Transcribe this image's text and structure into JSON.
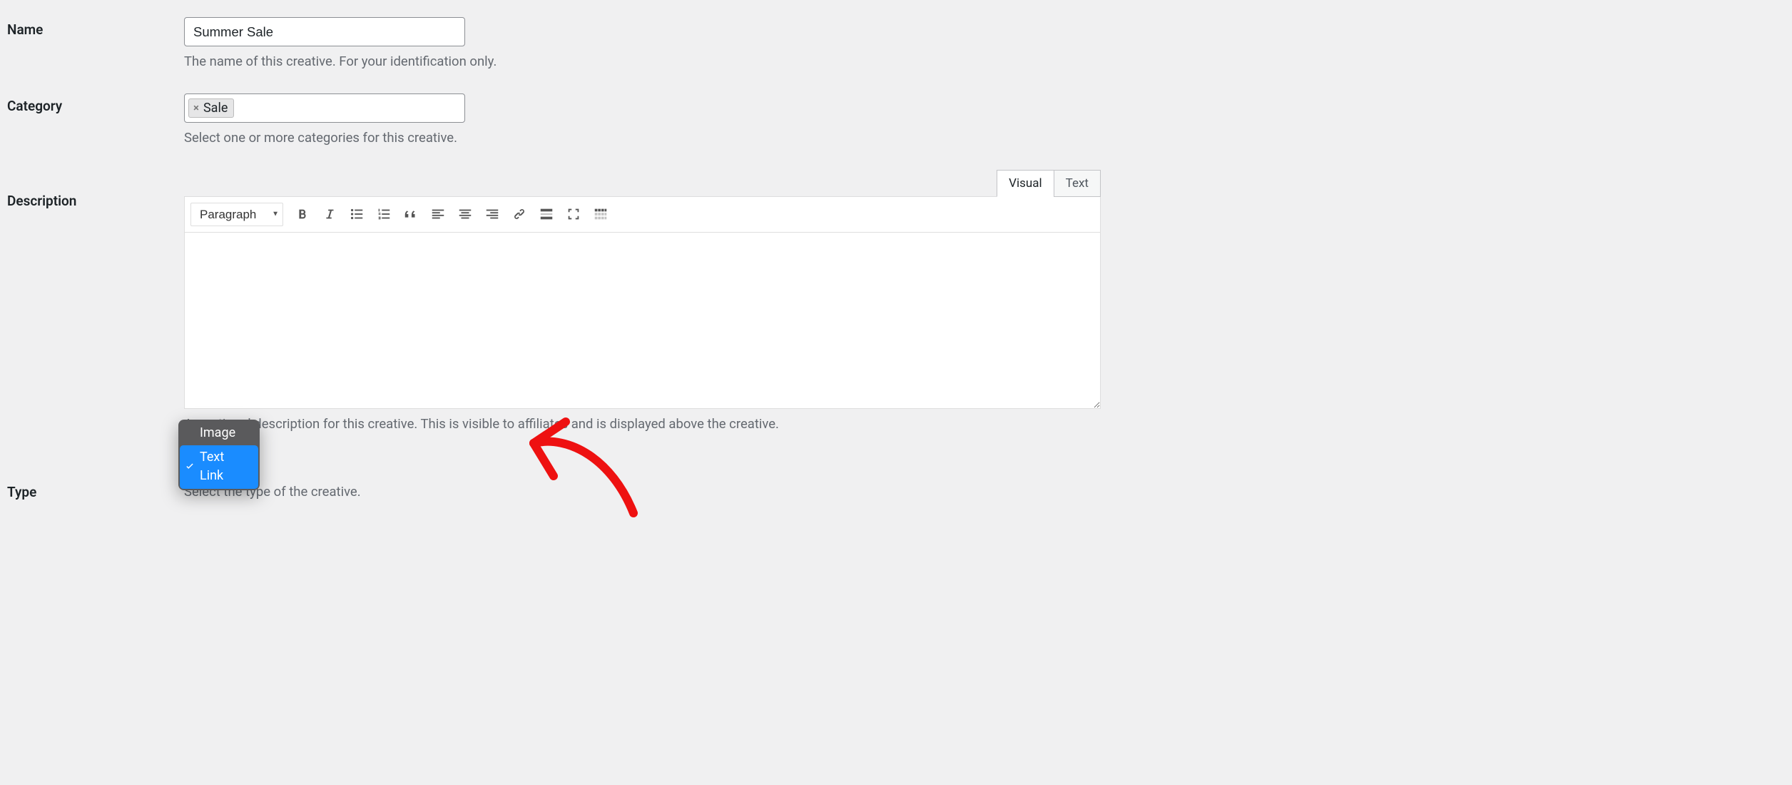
{
  "fields": {
    "name": {
      "label": "Name",
      "value": "Summer Sale",
      "helper": "The name of this creative. For your identification only."
    },
    "category": {
      "label": "Category",
      "tags": [
        "Sale"
      ],
      "helper": "Select one or more categories for this creative."
    },
    "description": {
      "label": "Description",
      "format_select": "Paragraph",
      "tabs": {
        "visual": "Visual",
        "text": "Text",
        "active": "visual"
      },
      "value": "",
      "helper": "An optional description for this creative. This is visible to affiliates and is displayed above the creative."
    },
    "type": {
      "label": "Type",
      "options": [
        "Image",
        "Text Link"
      ],
      "selected": "Text Link",
      "helper": "Select the type of the creative."
    }
  },
  "toolbar_icons": [
    "bold-icon",
    "italic-icon",
    "bullet-list-icon",
    "numbered-list-icon",
    "blockquote-icon",
    "align-left-icon",
    "align-center-icon",
    "align-right-icon",
    "link-icon",
    "insert-more-icon",
    "fullscreen-icon",
    "toolbar-toggle-icon"
  ]
}
